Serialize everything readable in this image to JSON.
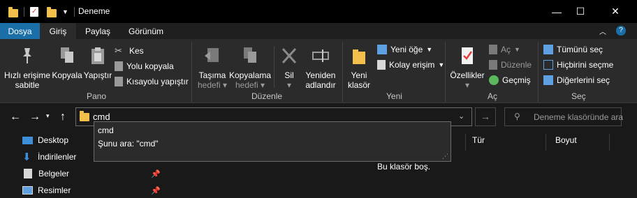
{
  "window": {
    "title": "Deneme"
  },
  "caption": {
    "minimize": "—",
    "maximize": "☐",
    "close": "✕"
  },
  "tabs": [
    {
      "label": "Dosya"
    },
    {
      "label": "Giriş"
    },
    {
      "label": "Paylaş"
    },
    {
      "label": "Görünüm"
    }
  ],
  "ribbon": {
    "pano": {
      "label": "Pano",
      "pin": "Hızlı erişime sabitle",
      "pin_l1": "Hızlı erişime",
      "pin_l2": "sabitle",
      "copy": "Kopyala",
      "paste": "Yapıştır",
      "cut": "Kes",
      "copy_path": "Yolu kopyala",
      "paste_shortcut": "Kısayolu yapıştır"
    },
    "duzenle": {
      "label": "Düzenle",
      "move_l1": "Taşıma",
      "move_l2": "hedefi",
      "copyto_l1": "Kopyalama",
      "copyto_l2": "hedefi",
      "delete": "Sil",
      "rename_l1": "Yeniden",
      "rename_l2": "adlandır"
    },
    "yeni": {
      "label": "Yeni",
      "new_folder_l1": "Yeni",
      "new_folder_l2": "klasör",
      "new_item": "Yeni öğe",
      "easy_access": "Kolay erişim"
    },
    "ac": {
      "label": "Aç",
      "properties": "Özellikler",
      "open": "Aç",
      "edit": "Düzenle",
      "history": "Geçmiş"
    },
    "sec": {
      "label": "Seç",
      "select_all": "Tümünü seç",
      "select_none": "Hiçbirini seçme",
      "invert": "Diğerlerini seç"
    }
  },
  "address": {
    "value": "cmd"
  },
  "search": {
    "placeholder": "Deneme klasöründe ara"
  },
  "suggestions": [
    {
      "text": "cmd"
    },
    {
      "text": "Şunu ara: \"cmd\""
    }
  ],
  "nav_pane": [
    {
      "label": "Desktop"
    },
    {
      "label": "İndirilenler"
    },
    {
      "label": "Belgeler"
    },
    {
      "label": "Resimler"
    }
  ],
  "columns": {
    "type": "Tür",
    "size": "Boyut"
  },
  "empty_message": "Bu klasör boş.",
  "colors": {
    "accent": "#1a6fa8",
    "folder": "#f2c04b",
    "background": "#191919",
    "ribbon": "#2b2b2b"
  }
}
